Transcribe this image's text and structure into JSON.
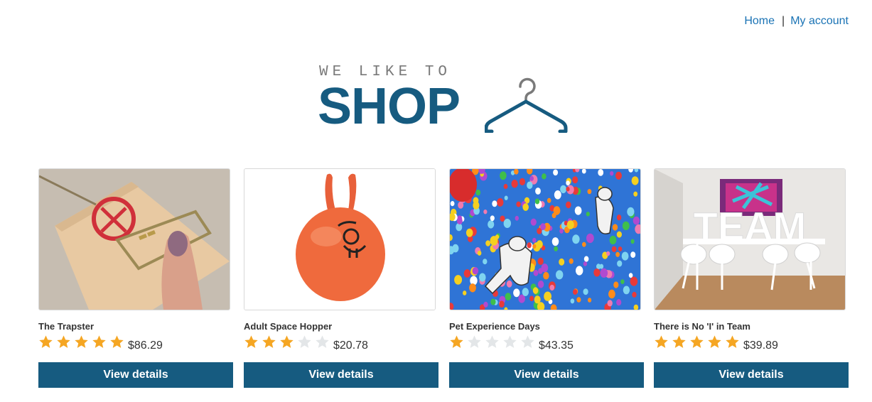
{
  "nav": {
    "home": "Home",
    "separator": "|",
    "account": "My account"
  },
  "logo": {
    "tagline": "WE LIKE TO",
    "wordmark": "SHOP",
    "brand_color": "#165b80"
  },
  "products": [
    {
      "name": "The Trapster",
      "rating": 5,
      "price": "$86.29",
      "button": "View details",
      "image": "mousetrap-image"
    },
    {
      "name": "Adult Space Hopper",
      "rating": 3,
      "price": "$20.78",
      "button": "View details",
      "image": "space-hopper-image"
    },
    {
      "name": "Pet Experience Days",
      "rating": 1,
      "price": "$43.35",
      "button": "View details",
      "image": "balloons-dogs-image"
    },
    {
      "name": "There is No 'I' in Team",
      "rating": 5,
      "price": "$39.89",
      "button": "View details",
      "image": "team-room-image"
    }
  ],
  "colors": {
    "star_filled": "#f5a623",
    "star_empty": "#e3e6e8",
    "button_bg": "#165b80",
    "link": "#1a73b5"
  }
}
